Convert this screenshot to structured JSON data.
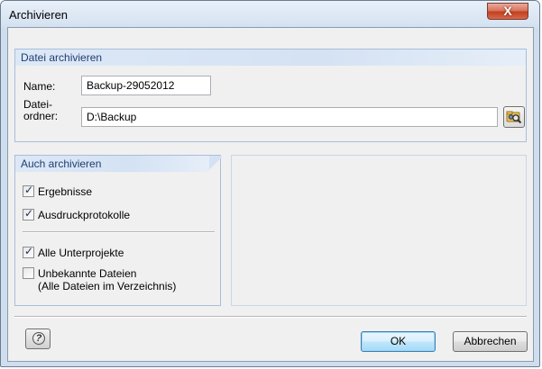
{
  "window": {
    "title": "Archivieren",
    "close_glyph": "X"
  },
  "archive_group": {
    "header": "Datei archivieren",
    "name_label": "Name:",
    "name_value": "Backup-29052012",
    "folder_label_line1": "Datei-",
    "folder_label_line2": "ordner:",
    "folder_value": "D:\\Backup",
    "browse_icon": "folder-search-icon"
  },
  "also_group": {
    "header": "Auch archivieren",
    "items": [
      {
        "label": "Ergebnisse",
        "checked": true
      },
      {
        "label": "Ausdruckprotokolle",
        "checked": true
      },
      {
        "label": "Alle Unterprojekte",
        "checked": true
      },
      {
        "label": "Unbekannte Dateien",
        "label2": "(Alle Dateien im Verzeichnis)",
        "checked": false
      }
    ]
  },
  "footer": {
    "help_icon": "help-icon",
    "ok_label": "OK",
    "cancel_label": "Abbrechen"
  },
  "colors": {
    "group_header_text": "#1f3d73",
    "group_border": "#a7bfdc",
    "close_button": "#c2401f"
  }
}
